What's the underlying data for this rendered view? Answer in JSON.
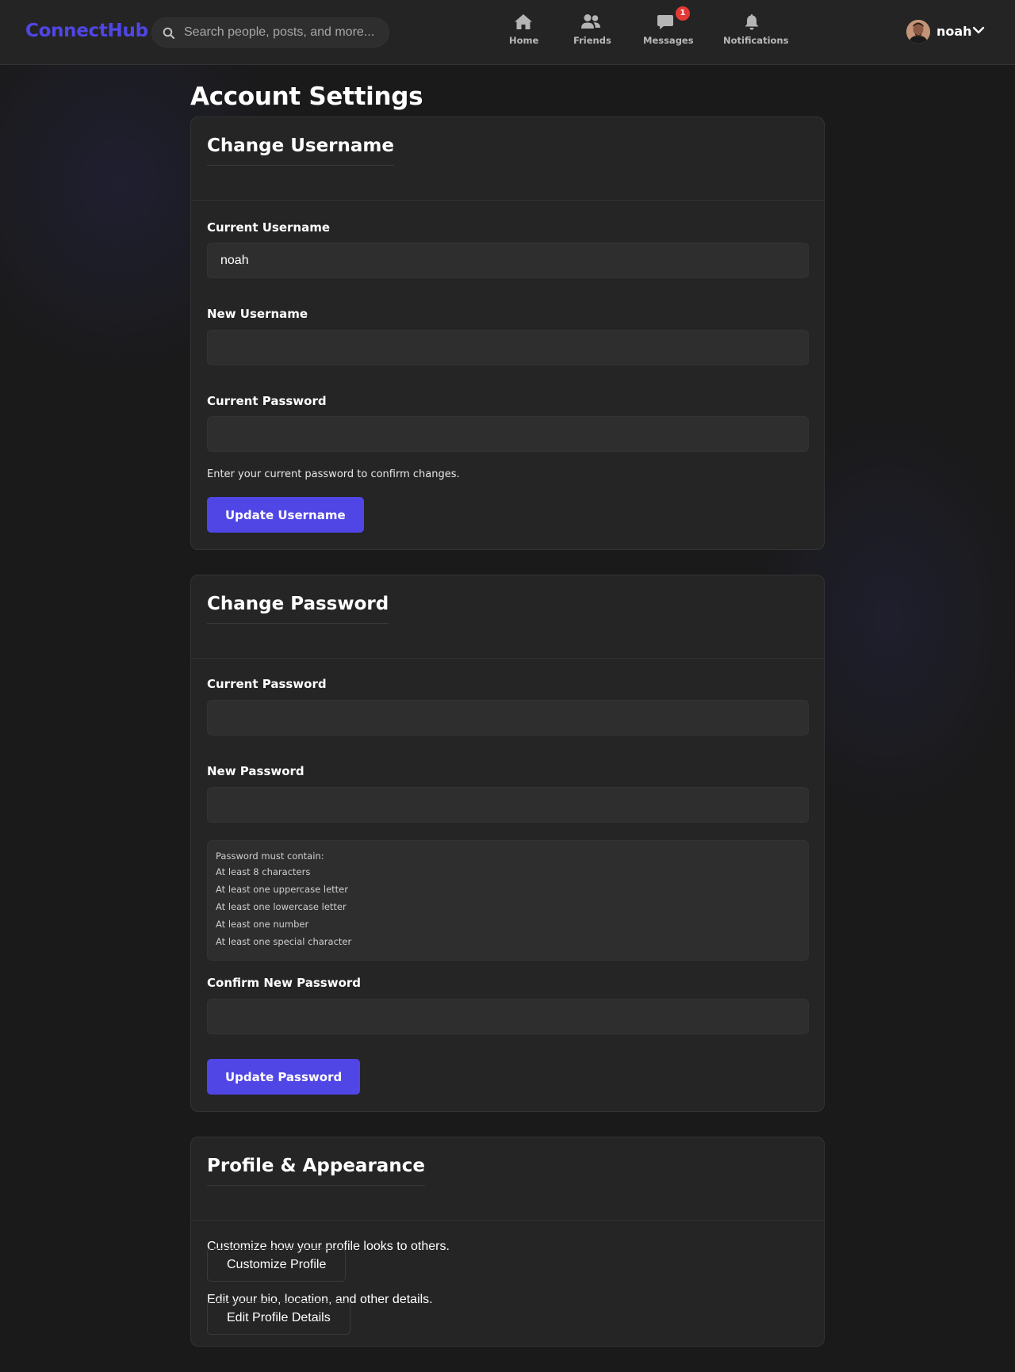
{
  "app": {
    "logo": "ConnectHub"
  },
  "search": {
    "placeholder": "Search people, posts, and more..."
  },
  "nav": {
    "home": "Home",
    "friends": "Friends",
    "messages": "Messages",
    "messages_badge": "1",
    "notifications": "Notifications"
  },
  "user": {
    "name": "noah"
  },
  "page": {
    "title": "Account Settings"
  },
  "change_username": {
    "title": "Change Username",
    "current_label": "Current Username",
    "current_value": "noah",
    "new_label": "New Username",
    "password_label": "Current Password",
    "hint": "Enter your current password to confirm changes.",
    "submit": "Update Username"
  },
  "change_password": {
    "title": "Change Password",
    "current_label": "Current Password",
    "new_label": "New Password",
    "requirements_title": "Password must contain:",
    "requirements": [
      "At least 8 characters",
      "At least one uppercase letter",
      "At least one lowercase letter",
      "At least one number",
      "At least one special character"
    ],
    "confirm_label": "Confirm New Password",
    "submit": "Update Password"
  },
  "profile_appearance": {
    "title": "Profile & Appearance",
    "customize_text": "Customize how your profile looks to others.",
    "customize_button": "Customize Profile",
    "edit_text": "Edit your bio, location, and other details.",
    "edit_button": "Edit Profile Details"
  },
  "colors": {
    "accent": "#5046e5",
    "badge": "#e53935",
    "background": "#1a1a1a",
    "card": "#252525"
  }
}
